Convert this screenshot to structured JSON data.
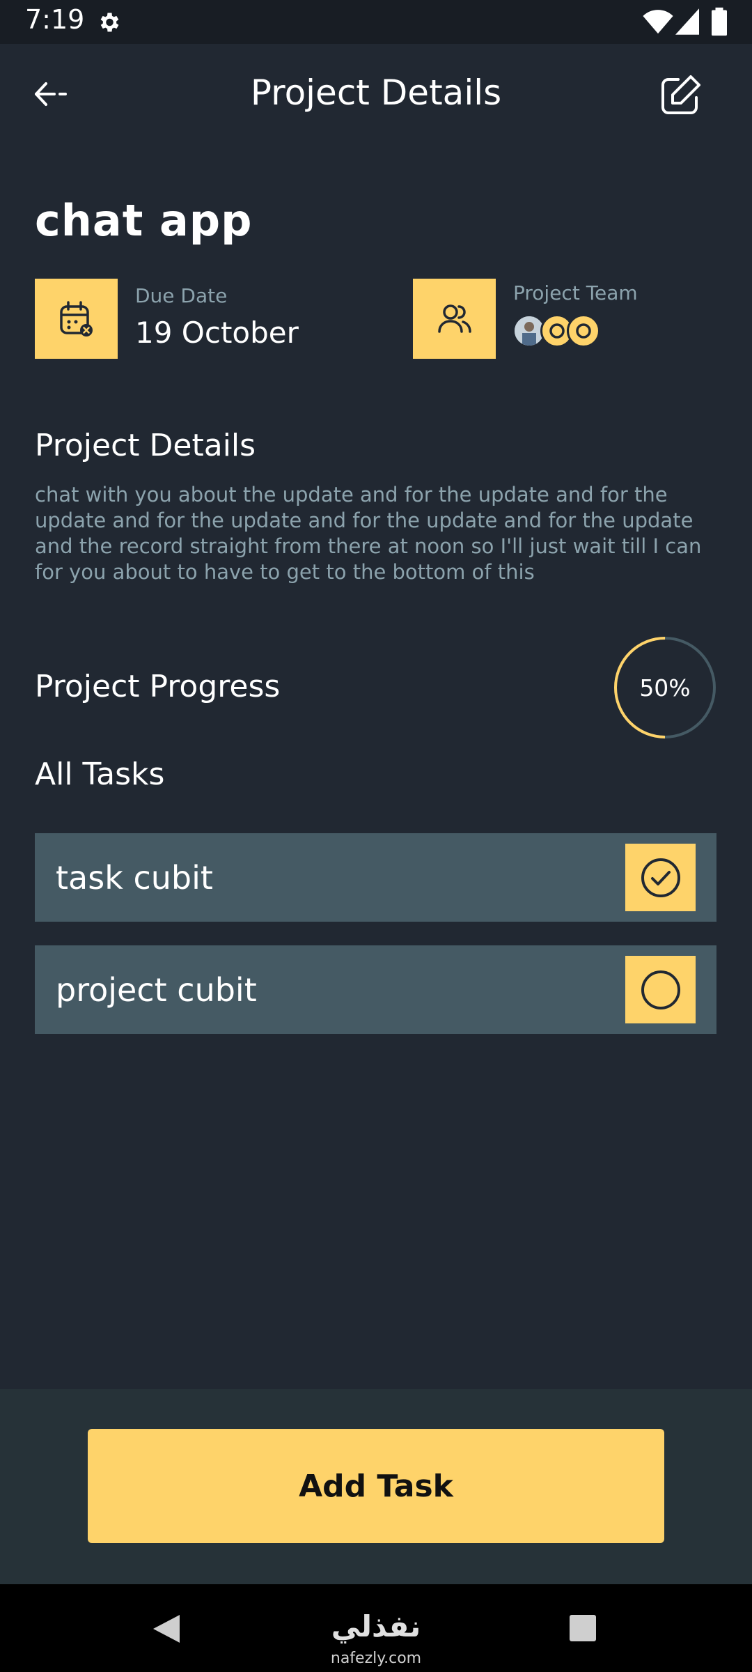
{
  "status_bar": {
    "time": "7:19"
  },
  "header": {
    "title": "Project Details"
  },
  "project": {
    "name": "chat app",
    "due_label": "Due Date",
    "due_value": "19 October",
    "team_label": "Project Team"
  },
  "details": {
    "heading": "Project Details",
    "text": "chat with you about the update and for the update and for the update and for the update and for the update and for the update and the record straight from there at noon so I'll just wait till I can for you about to have to get to the bottom of this"
  },
  "progress": {
    "heading": "Project Progress",
    "value": 0.5,
    "label": "50%"
  },
  "tasks": {
    "heading": "All Tasks",
    "items": [
      {
        "label": "task cubit",
        "done": true
      },
      {
        "label": "project cubit",
        "done": false
      }
    ]
  },
  "actions": {
    "add_task": "Add Task"
  },
  "watermark": {
    "logo": "نفذلي",
    "site": "nafezly.com"
  },
  "colors": {
    "accent": "#fed36a",
    "background": "#212832",
    "card": "#455a64",
    "muted": "#8ca3ad"
  }
}
